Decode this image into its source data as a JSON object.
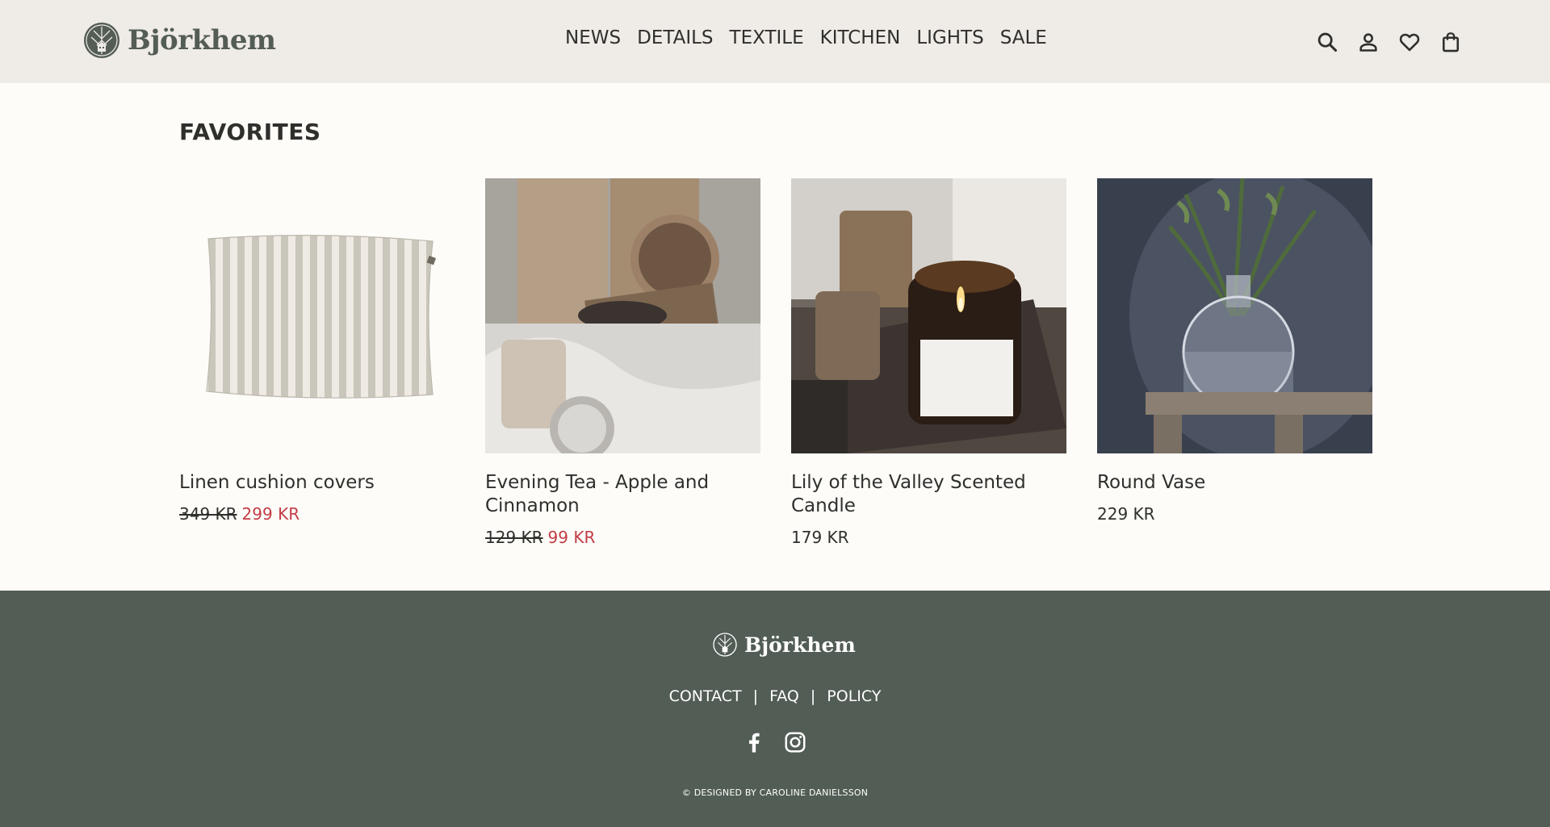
{
  "header": {
    "brand": "Björkhem",
    "nav": [
      "NEWS",
      "DETAILS",
      "TEXTILE",
      "KITCHEN",
      "LIGHTS",
      "SALE"
    ],
    "icons": [
      "search-icon",
      "account-icon",
      "heart-icon",
      "bag-icon"
    ]
  },
  "main": {
    "title": "FAVORITES",
    "products": [
      {
        "name": "Linen cushion covers",
        "old_price": "349 KR",
        "price": "299 KR",
        "on_sale": true
      },
      {
        "name": "Evening Tea - Apple and Cinnamon",
        "old_price": "129 KR",
        "price": "99 KR",
        "on_sale": true
      },
      {
        "name": "Lily of the Valley Scented Candle",
        "old_price": "",
        "price": "179 KR",
        "on_sale": false
      },
      {
        "name": "Round Vase",
        "old_price": "",
        "price": "229 KR",
        "on_sale": false
      }
    ]
  },
  "footer": {
    "brand": "Björkhem",
    "links": [
      "CONTACT",
      "FAQ",
      "POLICY"
    ],
    "separator": "|",
    "social": [
      "facebook-icon",
      "instagram-icon"
    ],
    "copyright": "© DESIGNED BY CAROLINE DANIELSSON"
  },
  "colors": {
    "header_bg": "#efebe6",
    "page_bg": "#fdfcf9",
    "footer_bg": "#525d55",
    "sale_red": "#c43c45",
    "brand_green": "#535d55"
  }
}
